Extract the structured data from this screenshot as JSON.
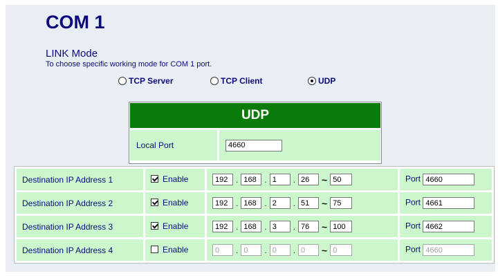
{
  "page": {
    "title": "COM 1",
    "link_heading": "LINK Mode",
    "link_description": "To choose specific working mode for COM 1 port."
  },
  "modes": [
    {
      "label": "TCP Server",
      "selected": false
    },
    {
      "label": "TCP Client",
      "selected": false
    },
    {
      "label": "UDP",
      "selected": true
    }
  ],
  "udp": {
    "header": "UDP",
    "local_port_label": "Local Port",
    "local_port_value": "4660"
  },
  "destinations": [
    {
      "label": "Destination IP Address 1",
      "enabled": true,
      "enable_label": "Enable",
      "ip": [
        "192",
        "168",
        "1",
        "26"
      ],
      "range_end": "50",
      "port_label": "Port",
      "port": "4660"
    },
    {
      "label": "Destination IP Address 2",
      "enabled": true,
      "enable_label": "Enable",
      "ip": [
        "192",
        "168",
        "2",
        "51"
      ],
      "range_end": "75",
      "port_label": "Port",
      "port": "4661"
    },
    {
      "label": "Destination IP Address 3",
      "enabled": true,
      "enable_label": "Enable",
      "ip": [
        "192",
        "168",
        "3",
        "76"
      ],
      "range_end": "100",
      "port_label": "Port",
      "port": "4662"
    },
    {
      "label": "Destination IP Address 4",
      "enabled": false,
      "enable_label": "Enable",
      "ip": [
        "0",
        "0",
        "0",
        "0"
      ],
      "range_end": "0",
      "port_label": "Port",
      "port": "4660"
    }
  ],
  "colors": {
    "header_green": "#0a7a0a",
    "cell_green": "#ccf7cc",
    "text_navy": "#0a0a7a",
    "page_bg": "#e9eef4"
  }
}
